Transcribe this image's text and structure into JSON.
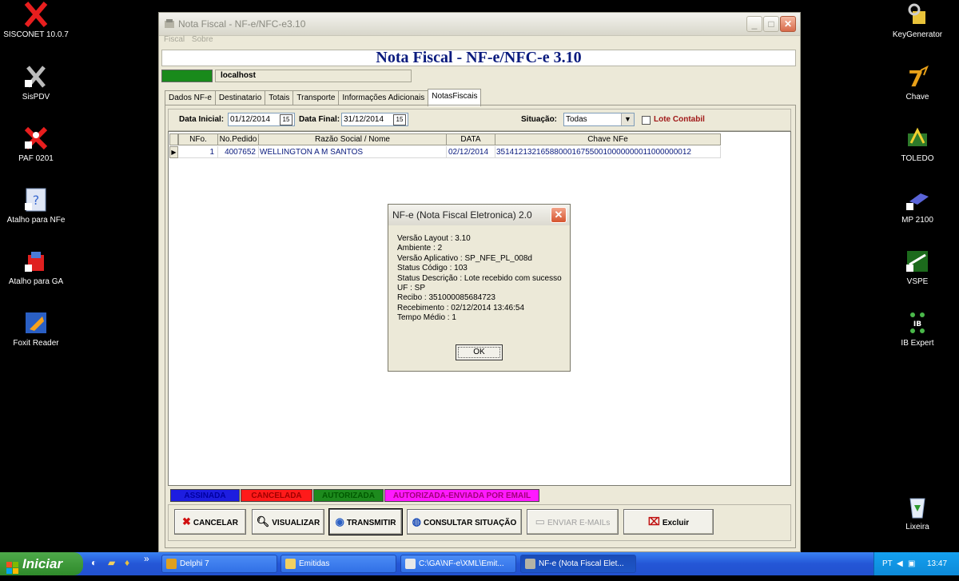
{
  "desktop_left": [
    {
      "label": "SISCONET 10.0.7",
      "icon": "sisconet-icon"
    },
    {
      "label": "SisPDV",
      "icon": "sispdv-icon"
    },
    {
      "label": "PAF 0201",
      "icon": "paf-icon"
    },
    {
      "label": "Atalho para NFe",
      "icon": "nfe-shortcut-icon"
    },
    {
      "label": "Atalho para GA",
      "icon": "ga-shortcut-icon"
    },
    {
      "label": "Foxit Reader",
      "icon": "foxit-icon"
    }
  ],
  "desktop_right": [
    {
      "label": "KeyGenerator",
      "icon": "keygenerator-icon"
    },
    {
      "label": "Chave",
      "icon": "chave-icon"
    },
    {
      "label": "TOLEDO",
      "icon": "toledo-icon"
    },
    {
      "label": "MP 2100",
      "icon": "mp2100-icon"
    },
    {
      "label": "VSPE",
      "icon": "vspe-icon"
    },
    {
      "label": "IB Expert",
      "icon": "ibexpert-icon"
    },
    {
      "label": "Lixeira",
      "icon": "recycle-bin-icon"
    }
  ],
  "window": {
    "title": "Nota Fiscal - NF-e/NFC-e3.10",
    "menu": [
      "Fiscal",
      "Sobre"
    ],
    "banner": "Nota Fiscal - NF-e/NFC-e 3.10",
    "host": "localhost",
    "tabs": [
      "Dados NF-e",
      "Destinatario",
      "Totais",
      "Transporte",
      "Informações Adicionais",
      "NotasFiscais"
    ],
    "filters": {
      "data_inicial_label": "Data Inicial:",
      "data_inicial": "01/12/2014",
      "data_final_label": "Data Final:",
      "data_final": "31/12/2014",
      "situacao_label": "Situação:",
      "situacao": "Todas",
      "lote_label": "Lote Contabil"
    },
    "grid": {
      "columns": [
        "NFo.",
        "No.Pedido",
        "Razão Social / Nome",
        "DATA",
        "Chave NFe"
      ],
      "rows": [
        [
          "1",
          "4007652",
          "WELLINGTON A M SANTOS",
          "02/12/2014",
          "35141213216588000167550010000000011000000012"
        ]
      ]
    },
    "legend": [
      {
        "label": "ASSINADA",
        "color": "#1d1de0",
        "text": "#0000a0"
      },
      {
        "label": "CANCELADA",
        "color": "#ff1a1a",
        "text": "#a00000"
      },
      {
        "label": "AUTORIZADA",
        "color": "#1d8a1d",
        "text": "#005a00"
      },
      {
        "label": "AUTORIZADA-ENVIADA POR EMAIL",
        "color": "#ff1aff",
        "text": "#a0007a"
      }
    ],
    "buttons": {
      "cancelar": "CANCELAR",
      "visualizar": "VISUALIZAR",
      "transmitir": "TRANSMITIR",
      "consultar": "CONSULTAR SITUAÇÃO",
      "enviar": "ENVIAR E-MAILs",
      "excluir": "Excluir"
    }
  },
  "dialog": {
    "title": "NF-e (Nota Fiscal Eletronica) 2.0",
    "lines": [
      "Versão Layout : 3.10",
      "Ambiente : 2",
      "Versão Aplicativo : SP_NFE_PL_008d",
      "Status Código : 103",
      "Status Descrição : Lote recebido com sucesso",
      "UF : SP",
      "Recibo : 351000085684723",
      "Recebimento : 02/12/2014 13:46:54",
      "Tempo Médio : 1"
    ],
    "ok": "OK"
  },
  "taskbar": {
    "start": "Iniciar",
    "tasks": [
      "Delphi 7",
      "Emitidas",
      "C:\\GA\\NF-e\\XML\\Emit...",
      "NF-e (Nota Fiscal Elet..."
    ],
    "lang": "PT",
    "clock": "13:47"
  }
}
